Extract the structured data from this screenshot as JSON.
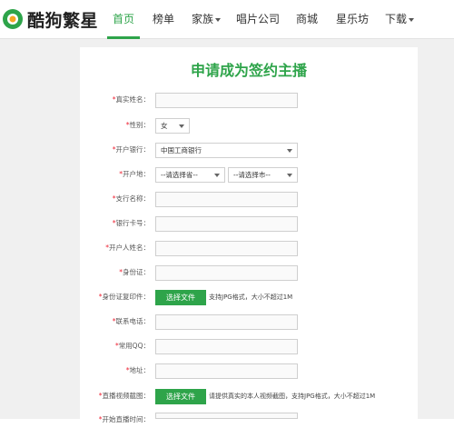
{
  "nav": {
    "logo_text": "酷狗繁星",
    "items": [
      {
        "label": "首页",
        "active": true
      },
      {
        "label": "榜单"
      },
      {
        "label": "家族",
        "dropdown": true
      },
      {
        "label": "唱片公司"
      },
      {
        "label": "商城"
      },
      {
        "label": "星乐坊"
      },
      {
        "label": "下载",
        "dropdown": true
      }
    ]
  },
  "form": {
    "title": "申请成为签约主播",
    "fields": {
      "real_name": "*真实姓名：",
      "gender": "*性别：",
      "gender_value": "女",
      "bank": "*开户银行：",
      "bank_value": "中国工商银行",
      "bank_location": "*开户地：",
      "province_placeholder": "--请选择省--",
      "city_placeholder": "--请选择市--",
      "branch": "*支行名称：",
      "card_no": "*银行卡号：",
      "account_name": "*开户人姓名：",
      "id_card": "*身份证：",
      "id_copy": "*身份证复印件：",
      "id_copy_button": "选择文件",
      "id_copy_hint": "支持JPG格式，大小不超过1M",
      "phone": "*联系电话：",
      "qq": "*常用QQ：",
      "address": "*地址：",
      "video_shot": "*直播视频截图：",
      "video_button": "选择文件",
      "video_hint": "请提供真实的本人视频截图，支持JPG格式，大小不超过1M",
      "next_label": "*开始直播时间："
    }
  },
  "colors": {
    "accent": "#2ea44a",
    "required": "#e22233"
  }
}
